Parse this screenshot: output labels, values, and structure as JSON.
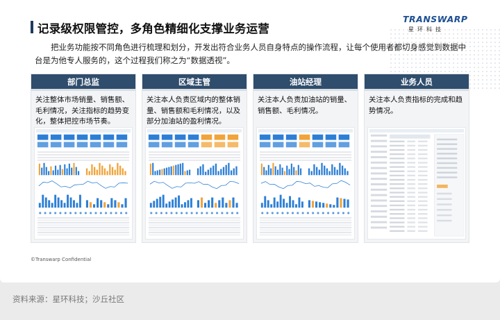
{
  "header": {
    "title": "记录级权限管控，多角色精细化支撑业务运营",
    "logo_main": "TRANSWARP",
    "logo_sub": "星环科技"
  },
  "intro": "把业务功能按不同角色进行梳理和划分，开发出符合业务人员自身特点的操作流程，让每个使用者都切身感觉到数据中台是为他专人服务的，这个过程我们称之为“数据透视”。",
  "roles": [
    {
      "title": "部门总监",
      "desc": "关注整体市场销量、销售额、毛利情况，关注指标的趋势变化，整体把控市场节奏。"
    },
    {
      "title": "区域主管",
      "desc": "关注本人负责区域内的整体销量、销售额和毛利情况，以及部分加油站的盈利情况。"
    },
    {
      "title": "油站经理",
      "desc": "关注本人负责加油站的销量、销售额、毛利情况。"
    },
    {
      "title": "业务人员",
      "desc": "关注本人负责指标的完成和趋势情况。"
    }
  ],
  "footer": {
    "copyright": "©Transwarp Confidential",
    "source": "资料来源：星环科技；沙丘社区"
  },
  "colors": {
    "header_bg": "#2f4d6c",
    "accent_blue": "#2d7fd6",
    "accent_orange": "#f0a43a",
    "logo_blue": "#1d4f91"
  }
}
